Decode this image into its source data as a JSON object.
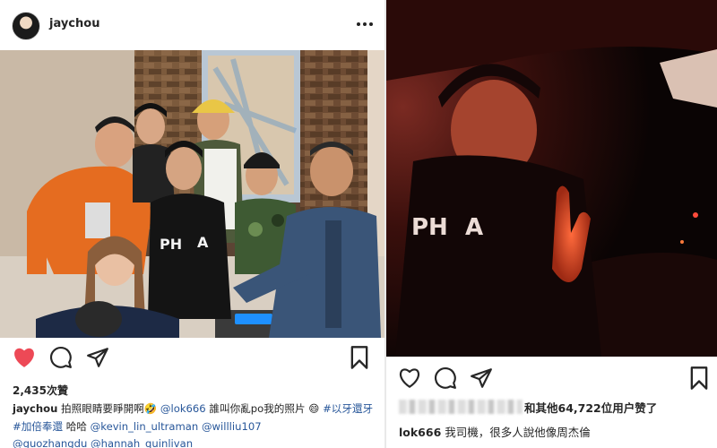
{
  "left_post": {
    "username": "jaychou",
    "likes": "2,435次贊",
    "caption": {
      "username": "jaychou",
      "part1": "拍照眼睛要睜開啊",
      "emoji1": "🤣",
      "mention1": "@lok666",
      "part2": "誰叫你亂po我的照片",
      "emoji2": "😄",
      "hashtag1": "#以牙還牙",
      "hashtag2": "#加倍奉還",
      "part3": "哈哈",
      "mention2": "@kevin_lin_ultraman",
      "mention3": "@willliu107",
      "mention4": "@guozhangdu",
      "mention5": "@hannah_quinlivan"
    },
    "icons": [
      "more-icon",
      "heart-filled-icon",
      "comment-icon",
      "share-icon",
      "bookmark-icon"
    ],
    "colors": {
      "heart": "#ed4956",
      "link": "#28579a"
    }
  },
  "right_post": {
    "likes_text": "和其他64,722位用户赞了",
    "caption": {
      "username": "lok666",
      "text": "我司機，很多人說他像周杰倫"
    },
    "icons": [
      "heart-outline-icon",
      "comment-icon",
      "share-icon",
      "bookmark-icon"
    ]
  }
}
